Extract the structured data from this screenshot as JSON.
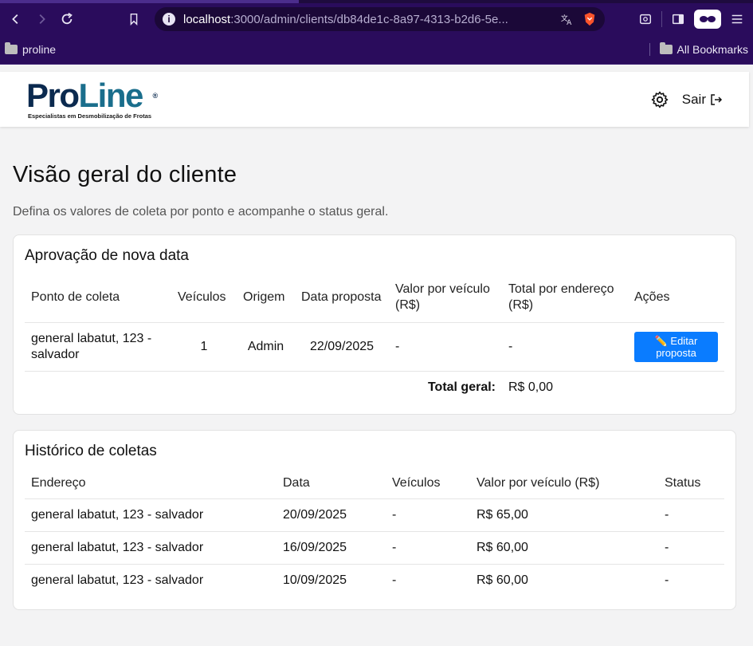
{
  "browser": {
    "url_host": "localhost",
    "url_path": ":3000/admin/clients/db84de1c-8a97-4313-b2d6-5e...",
    "bookmarks_left": "proline",
    "bookmarks_right": "All Bookmarks"
  },
  "header": {
    "logo_pro": "Pro",
    "logo_line": "Line",
    "logo_reg": "®",
    "logo_tagline": "Especialistas em Desmobilização de Frotas",
    "logout_label": "Sair"
  },
  "page": {
    "title": "Visão geral do cliente",
    "subtitle": "Defina os valores de coleta por ponto e acompanhe o status geral."
  },
  "approval": {
    "title": "Aprovação de nova data",
    "columns": [
      "Ponto de coleta",
      "Veículos",
      "Origem",
      "Data proposta",
      "Valor por veículo (R$)",
      "Total por endereço (R$)",
      "Ações"
    ],
    "rows": [
      {
        "point": "general labatut, 123 - salvador",
        "vehicles": "1",
        "origin": "Admin",
        "date": "22/09/2025",
        "value_per_vehicle": "-",
        "total_per_address": "-",
        "action_label": "✏️ Editar proposta"
      }
    ],
    "total_label": "Total geral:",
    "total_value": "R$ 0,00"
  },
  "history": {
    "title": "Histórico de coletas",
    "columns": [
      "Endereço",
      "Data",
      "Veículos",
      "Valor por veículo (R$)",
      "Status"
    ],
    "rows": [
      {
        "address": "general labatut, 123 - salvador",
        "date": "20/09/2025",
        "vehicles": "-",
        "value": "R$ 65,00",
        "status": "-"
      },
      {
        "address": "general labatut, 123 - salvador",
        "date": "16/09/2025",
        "vehicles": "-",
        "value": "R$ 60,00",
        "status": "-"
      },
      {
        "address": "general labatut, 123 - salvador",
        "date": "10/09/2025",
        "vehicles": "-",
        "value": "R$ 60,00",
        "status": "-"
      }
    ]
  },
  "colors": {
    "browser_bg": "#2a0c5c",
    "brand_dark": "#0b2a4f",
    "brand_teal": "#1a6e8c",
    "primary_button": "#0a7cff"
  }
}
